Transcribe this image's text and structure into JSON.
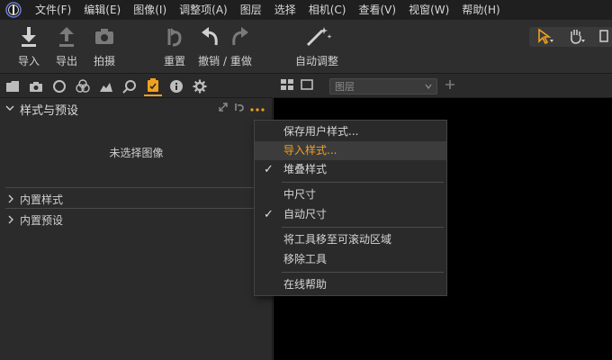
{
  "menubar": {
    "items": [
      "文件(F)",
      "编辑(E)",
      "图像(I)",
      "调整项(A)",
      "图层",
      "选择",
      "相机(C)",
      "查看(V)",
      "视窗(W)",
      "帮助(H)"
    ]
  },
  "toolbar": {
    "import_label": "导入",
    "export_label": "导出",
    "capture_label": "拍摄",
    "reset_label": "重置",
    "undo_redo_label": "撤销 / 重做",
    "auto_adjust_label": "自动调整"
  },
  "tool_tabs": [
    "library-icon",
    "camera-icon",
    "lens-icon",
    "color-icon",
    "exposure-icon",
    "search-icon",
    "styles-icon",
    "info-icon",
    "settings-icon"
  ],
  "panel": {
    "title": "样式与预设",
    "empty_message": "未选择图像",
    "sections": [
      "内置样式",
      "内置预设"
    ]
  },
  "viewer": {
    "layer_placeholder": "图层"
  },
  "context_menu": {
    "items": [
      {
        "label": "保存用户样式...",
        "checked": false,
        "highlighted": false
      },
      {
        "label": "导入样式...",
        "checked": false,
        "highlighted": true
      },
      {
        "label": "堆叠样式",
        "checked": true,
        "highlighted": false
      },
      {
        "label": "中尺寸",
        "checked": false,
        "highlighted": false
      },
      {
        "label": "自动尺寸",
        "checked": true,
        "highlighted": false
      },
      {
        "label": "将工具移至可滚动区域",
        "checked": false,
        "highlighted": false
      },
      {
        "label": "移除工具",
        "checked": false,
        "highlighted": false
      },
      {
        "label": "在线帮助",
        "checked": false,
        "highlighted": false
      }
    ],
    "check_glyph": "✓"
  },
  "colors": {
    "accent": "#f0a020",
    "background": "#2b2b2b",
    "viewer": "#000000"
  }
}
